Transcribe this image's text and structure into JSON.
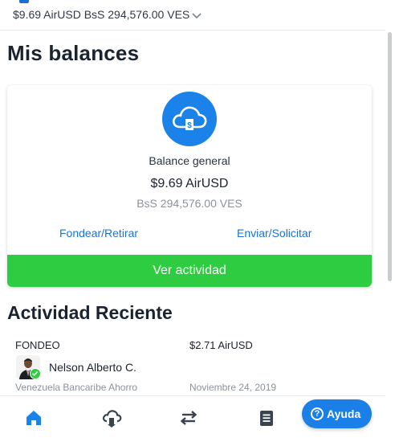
{
  "header": {
    "balance_summary": "$9.69 AirUSD  BsS 294,576.00 VES",
    "chevron_icon": "chevron-down-icon"
  },
  "page": {
    "title": "Mis balances"
  },
  "balance_card": {
    "icon": "cloud-dollar-icon",
    "label": "Balance general",
    "amount": "$9.69 AirUSD",
    "amount_ves": "BsS 294,576.00 VES",
    "fund_link": "Fondear/Retirar",
    "send_link": "Enviar/Solicitar",
    "activity_button": "Ver actividad"
  },
  "recent_activity": {
    "title": "Actividad Reciente",
    "items": [
      {
        "type": "FONDEO",
        "amount": "$2.71 AirUSD",
        "name": "Nelson Alberto C.",
        "bank": "Venezuela Bancaribe Ahorro",
        "date": "Noviembre 24, 2019"
      }
    ]
  },
  "bottom_nav": {
    "items": [
      "home-icon",
      "cloud-transfer-icon",
      "transfer-arrows-icon",
      "document-icon"
    ],
    "active": "home-icon"
  },
  "help": {
    "label": "Ayuda",
    "icon": "question-icon"
  },
  "colors": {
    "primary_blue": "#1a82e8",
    "action_green": "#2ecc40",
    "link_blue": "#1b73d6",
    "muted_text": "#8a939e"
  }
}
